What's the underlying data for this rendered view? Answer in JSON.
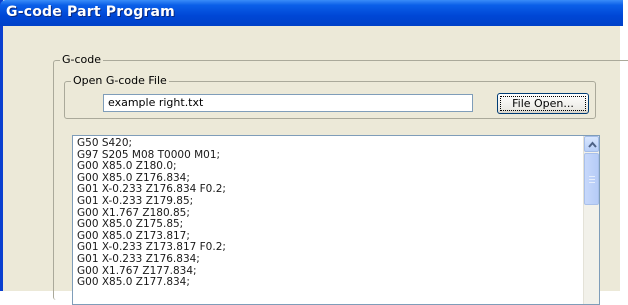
{
  "window": {
    "title": "G-code Part Program"
  },
  "gcode_group": {
    "legend": "G-code"
  },
  "open_file_group": {
    "legend": "Open G-code File",
    "file_name": "example right.txt",
    "open_button_label": "File Open..."
  },
  "code_list": {
    "lines": [
      "G50 S420;",
      "G97 S205 M08 T0000 M01;",
      "G00 X85.0 Z180.0;",
      "G00 X85.0 Z176.834;",
      "G01 X-0.233 Z176.834 F0.2;",
      "G01 X-0.233 Z179.85;",
      "G00 X1.767 Z180.85;",
      "G00 X85.0 Z175.85;",
      "G00 X85.0 Z173.817;",
      "G01 X-0.233 Z173.817 F0.2;",
      "G01 X-0.233 Z176.834;",
      "G00 X1.767 Z177.834;",
      "G00 X85.0 Z177.834;"
    ]
  },
  "colors": {
    "titlebar": "#0047d6",
    "window_face": "#ece9d8",
    "input_border": "#7f9db9"
  },
  "icons": {
    "scroll_up": "chevron-up-icon"
  }
}
